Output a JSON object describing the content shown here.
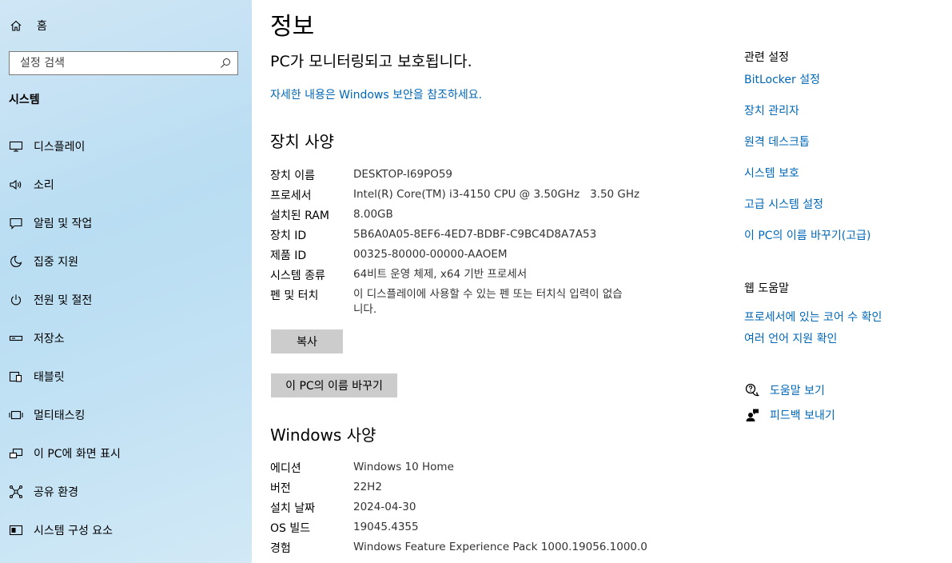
{
  "sidebar": {
    "home_label": "홈",
    "search": {
      "placeholder": "설정 검색"
    },
    "section_title": "시스템",
    "items": [
      {
        "label": "디스플레이",
        "icon": "monitor-icon"
      },
      {
        "label": "소리",
        "icon": "speaker-icon"
      },
      {
        "label": "알림 및 작업",
        "icon": "notification-icon"
      },
      {
        "label": "집중 지원",
        "icon": "moon-icon"
      },
      {
        "label": "전원 및 절전",
        "icon": "power-icon"
      },
      {
        "label": "저장소",
        "icon": "storage-icon"
      },
      {
        "label": "태블릿",
        "icon": "tablet-icon"
      },
      {
        "label": "멀티태스킹",
        "icon": "multitasking-icon"
      },
      {
        "label": "이 PC에 화면 표시",
        "icon": "project-icon"
      },
      {
        "label": "공유 환경",
        "icon": "shared-experiences-icon"
      },
      {
        "label": "시스템 구성 요소",
        "icon": "components-icon"
      }
    ]
  },
  "main": {
    "title": "정보",
    "protected_text": "PC가 모니터링되고 보호됩니다.",
    "security_link": "자세한 내용은 Windows 보안을 참조하세요.",
    "device_spec_heading": "장치 사양",
    "device_specs": [
      {
        "key": "장치 이름",
        "value": "DESKTOP-I69PO59"
      },
      {
        "key": "프로세서",
        "value": "Intel(R) Core(TM) i3-4150 CPU @ 3.50GHz   3.50 GHz"
      },
      {
        "key": "설치된 RAM",
        "value": "8.00GB"
      },
      {
        "key": "장치 ID",
        "value": "5B6A0A05-8EF6-4ED7-BDBF-C9BC4D8A7A53"
      },
      {
        "key": "제품 ID",
        "value": "00325-80000-00000-AAOEM"
      },
      {
        "key": "시스템 종류",
        "value": "64비트 운영 체제, x64 기반 프로세서"
      },
      {
        "key": "펜 및 터치",
        "value": "이 디스플레이에 사용할 수 있는 펜 또는 터치식 입력이 없습니다."
      }
    ],
    "copy_button": "복사",
    "rename_button": "이 PC의 이름 바꾸기",
    "windows_spec_heading": "Windows 사양",
    "windows_specs": [
      {
        "key": "에디션",
        "value": "Windows 10 Home"
      },
      {
        "key": "버전",
        "value": "22H2"
      },
      {
        "key": "설치 날짜",
        "value": "2024-04-30"
      },
      {
        "key": "OS 빌드",
        "value": "19045.4355"
      },
      {
        "key": "경험",
        "value": "Windows Feature Experience Pack 1000.19056.1000.0"
      }
    ]
  },
  "right": {
    "related_heading": "관련 설정",
    "related_links": [
      "BitLocker 설정",
      "장치 관리자",
      "원격 데스크톱",
      "시스템 보호",
      "고급 시스템 설정",
      "이 PC의 이름 바꾸기(고급)"
    ],
    "web_help_heading": "웹 도움말",
    "web_help_links": [
      "프로세서에 있는 코어 수 확인",
      "여러 언어 지원 확인"
    ],
    "help_link": "도움말 보기",
    "feedback_link": "피드백 보내기"
  },
  "colors": {
    "link": "#0067b8",
    "button": "#cccccc",
    "sidebar": "#c3e2f4"
  }
}
